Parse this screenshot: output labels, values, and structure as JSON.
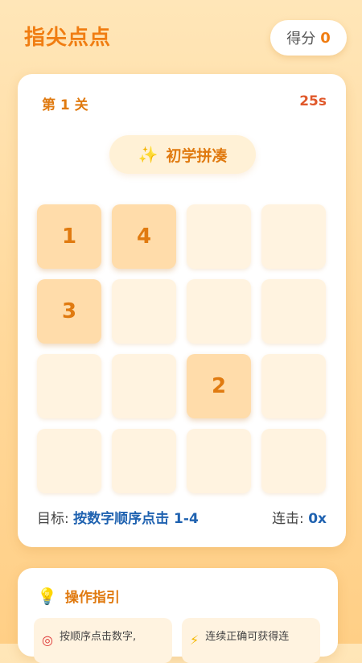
{
  "header": {
    "title": "指尖点点",
    "score_label": "得分",
    "score_value": "0"
  },
  "game": {
    "level_label": "第 1 关",
    "timer": "25s",
    "mode": {
      "icon": "sparkles-icon",
      "label": "初学拼凑"
    },
    "grid": {
      "rows": 4,
      "cols": 4,
      "tiles": [
        "1",
        "4",
        "",
        "",
        "3",
        "",
        "",
        "",
        "",
        "",
        "2",
        "",
        "",
        "",
        "",
        ""
      ]
    },
    "target_label": "目标:",
    "target_value": "按数字顺序点击 1-4",
    "combo_label": "连击:",
    "combo_value": "0x"
  },
  "guide": {
    "icon": "lightbulb-icon",
    "title": "操作指引",
    "items": [
      {
        "icon": "target-icon",
        "text": "按顺序点击数字,"
      },
      {
        "icon": "lightning-icon",
        "text": "连续正确可获得连"
      }
    ]
  },
  "colors": {
    "accent": "#f07d12",
    "timer": "#e0582a",
    "link": "#1f62b0",
    "tile_active": "#ffdcaa",
    "tile_empty": "#fff3e0"
  }
}
